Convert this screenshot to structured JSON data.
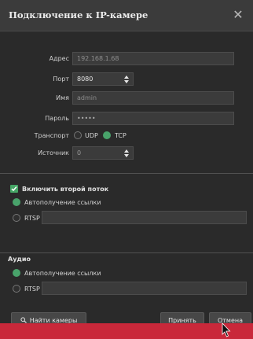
{
  "dialog": {
    "title": "Подключение к IP-камере",
    "close_glyph": "✕"
  },
  "form": {
    "address_label": "Адрес",
    "address_placeholder": "192.168.1.68",
    "port_label": "Порт",
    "port_value": "8080",
    "name_label": "Имя",
    "name_placeholder": "admin",
    "password_label": "Пароль",
    "password_value": "•••••",
    "transport_label": "Транспорт",
    "transport_options": [
      "UDP",
      "TCP"
    ],
    "transport_selected": "TCP",
    "source_label": "Источник",
    "source_value": "0"
  },
  "second_stream": {
    "checkbox_label": "Включить второй поток",
    "checked": true,
    "auto_label": "Автополучение ссылки",
    "rtsp_label": "RTSP",
    "selected": "auto"
  },
  "audio": {
    "section_label": "Аудио",
    "auto_label": "Автополучение ссылки",
    "rtsp_label": "RTSP",
    "selected": "auto"
  },
  "footer": {
    "find_button": "Найти камеры",
    "apply_button": "Принять",
    "cancel_button": "Отмена"
  },
  "colors": {
    "background": "#2a2a2a",
    "accent_green": "#49a36b",
    "alert_red": "#c9283a"
  },
  "icons": {
    "close": "close-icon",
    "checkbox": "check-icon",
    "search": "search-icon",
    "cursor": "mouse-pointer-icon"
  }
}
